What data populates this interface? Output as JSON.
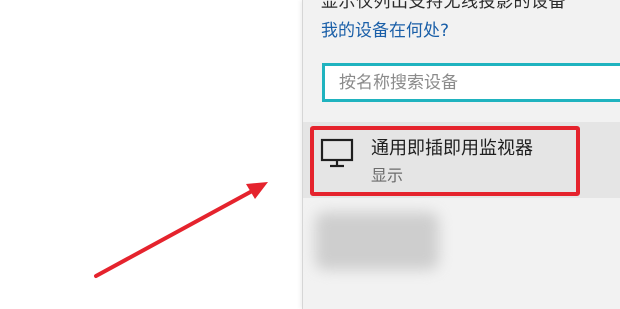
{
  "panel": {
    "cut_off_text": "显示仅列出支持无线投影的设备",
    "help_link": "我的设备在何处?",
    "search": {
      "placeholder": "按名称搜索设备",
      "value": ""
    },
    "devices": [
      {
        "name": "通用即插即用监视器",
        "type": "显示",
        "icon": "monitor-icon"
      }
    ]
  },
  "colors": {
    "accent": "#1fb3bf",
    "annotation": "#e5232d",
    "link": "#1a5fa8"
  }
}
